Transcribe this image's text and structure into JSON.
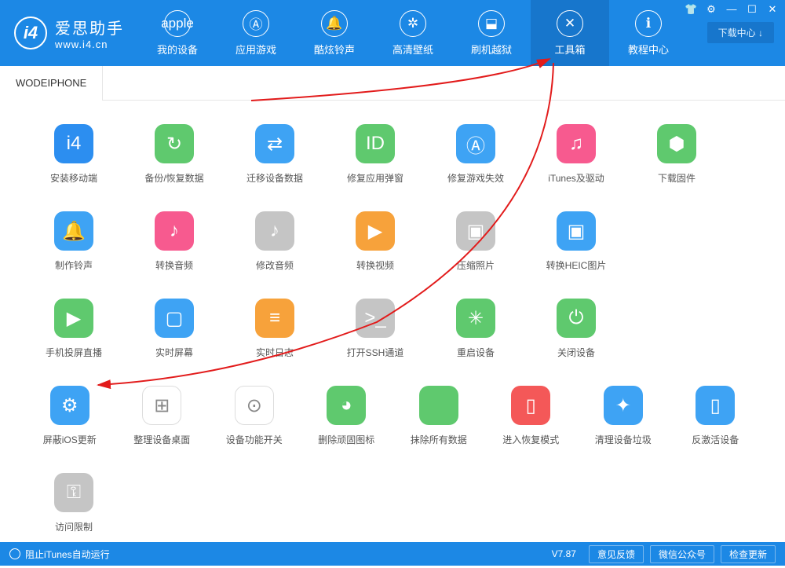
{
  "header": {
    "logo_text": "i4",
    "title": "爱思助手",
    "url": "www.i4.cn",
    "download_btn": "下载中心 ↓"
  },
  "nav": [
    {
      "label": "我的设备",
      "icon": "apple"
    },
    {
      "label": "应用游戏",
      "icon": "A"
    },
    {
      "label": "酷炫铃声",
      "icon": "bell"
    },
    {
      "label": "高清壁纸",
      "icon": "flower"
    },
    {
      "label": "刷机越狱",
      "icon": "box"
    },
    {
      "label": "工具箱",
      "icon": "tools",
      "active": true
    },
    {
      "label": "教程中心",
      "icon": "i"
    }
  ],
  "device_tab": "WODEIPHONE",
  "tools": [
    [
      {
        "label": "安装移动端",
        "color": "c-blue",
        "glyph": "i4"
      },
      {
        "label": "备份/恢复数据",
        "color": "c-green",
        "glyph": "↻"
      },
      {
        "label": "迁移设备数据",
        "color": "c-lblue",
        "glyph": "⇄"
      },
      {
        "label": "修复应用弹窗",
        "color": "c-green",
        "glyph": "ID"
      },
      {
        "label": "修复游戏失效",
        "color": "c-lblue",
        "glyph": "Ⓐ"
      },
      {
        "label": "iTunes及驱动",
        "color": "c-pink",
        "glyph": "♫"
      },
      {
        "label": "下载固件",
        "color": "c-green",
        "glyph": "⬢"
      }
    ],
    [
      {
        "label": "制作铃声",
        "color": "c-lblue",
        "glyph": "🔔"
      },
      {
        "label": "转换音频",
        "color": "c-pink",
        "glyph": "♪"
      },
      {
        "label": "修改音频",
        "color": "c-gray",
        "glyph": "♪"
      },
      {
        "label": "转换视频",
        "color": "c-orange",
        "glyph": "▶"
      },
      {
        "label": "压缩照片",
        "color": "c-gray",
        "glyph": "▣"
      },
      {
        "label": "转换HEIC图片",
        "color": "c-lblue",
        "glyph": "▣"
      }
    ],
    [
      {
        "label": "手机投屏直播",
        "color": "c-green",
        "glyph": "▶"
      },
      {
        "label": "实时屏幕",
        "color": "c-lblue",
        "glyph": "▢"
      },
      {
        "label": "实时日志",
        "color": "c-orange",
        "glyph": "≡"
      },
      {
        "label": "打开SSH通道",
        "color": "c-gray",
        "glyph": ">_"
      },
      {
        "label": "重启设备",
        "color": "c-green",
        "glyph": "✳"
      },
      {
        "label": "关闭设备",
        "color": "c-green",
        "glyph": "⏻"
      }
    ],
    [
      {
        "label": "屏蔽iOS更新",
        "color": "c-lblue",
        "glyph": "⚙"
      },
      {
        "label": "整理设备桌面",
        "color": "c-white",
        "glyph": "⊞"
      },
      {
        "label": "设备功能开关",
        "color": "c-white",
        "glyph": "⊙"
      },
      {
        "label": "删除顽固图标",
        "color": "c-green",
        "glyph": "◕"
      },
      {
        "label": "抹除所有数据",
        "color": "c-green",
        "glyph": ""
      },
      {
        "label": "进入恢复模式",
        "color": "c-red",
        "glyph": "▯"
      },
      {
        "label": "清理设备垃圾",
        "color": "c-lblue",
        "glyph": "✦"
      },
      {
        "label": "反激活设备",
        "color": "c-lblue",
        "glyph": "▯"
      }
    ],
    [
      {
        "label": "访问限制",
        "color": "c-gray",
        "glyph": "⚿"
      }
    ]
  ],
  "footer": {
    "left_text": "阻止iTunes自动运行",
    "version": "V7.87",
    "buttons": [
      "意见反馈",
      "微信公众号",
      "检查更新"
    ]
  }
}
